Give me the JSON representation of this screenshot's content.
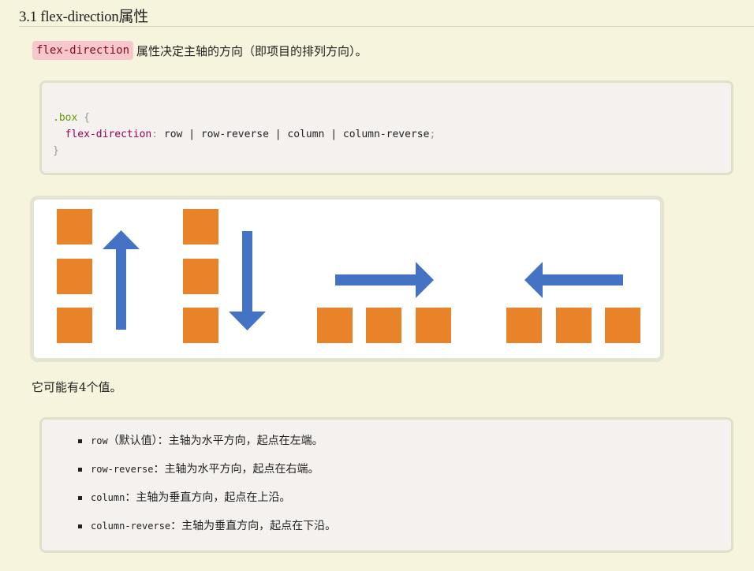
{
  "section": {
    "heading": "3.1 flex-direction属性"
  },
  "intro": {
    "chip": "flex-direction",
    "text": "属性决定主轴的方向（即项目的排列方向）。"
  },
  "code": {
    "line1_selector": ".box",
    "line1_brace": "{",
    "line2_prop": "flex-direction",
    "line2_colon": ":",
    "line2_values": " row | row-reverse | column | column-reverse",
    "line2_semicolon": ";",
    "line3_brace": "}"
  },
  "diagram": {
    "box_color": "#e8832a",
    "arrow_color": "#4472c4",
    "groups": [
      "column-reverse",
      "column",
      "row",
      "row-reverse"
    ]
  },
  "sentence": "它可能有4个值。",
  "values_list": [
    {
      "code": "row",
      "text": "（默认值）：主轴为水平方向，起点在左端。"
    },
    {
      "code": "row-reverse",
      "text": "：主轴为水平方向，起点在右端。"
    },
    {
      "code": "column",
      "text": "：主轴为垂直方向，起点在上沿。"
    },
    {
      "code": "column-reverse",
      "text": "：主轴为垂直方向，起点在下沿。"
    }
  ]
}
